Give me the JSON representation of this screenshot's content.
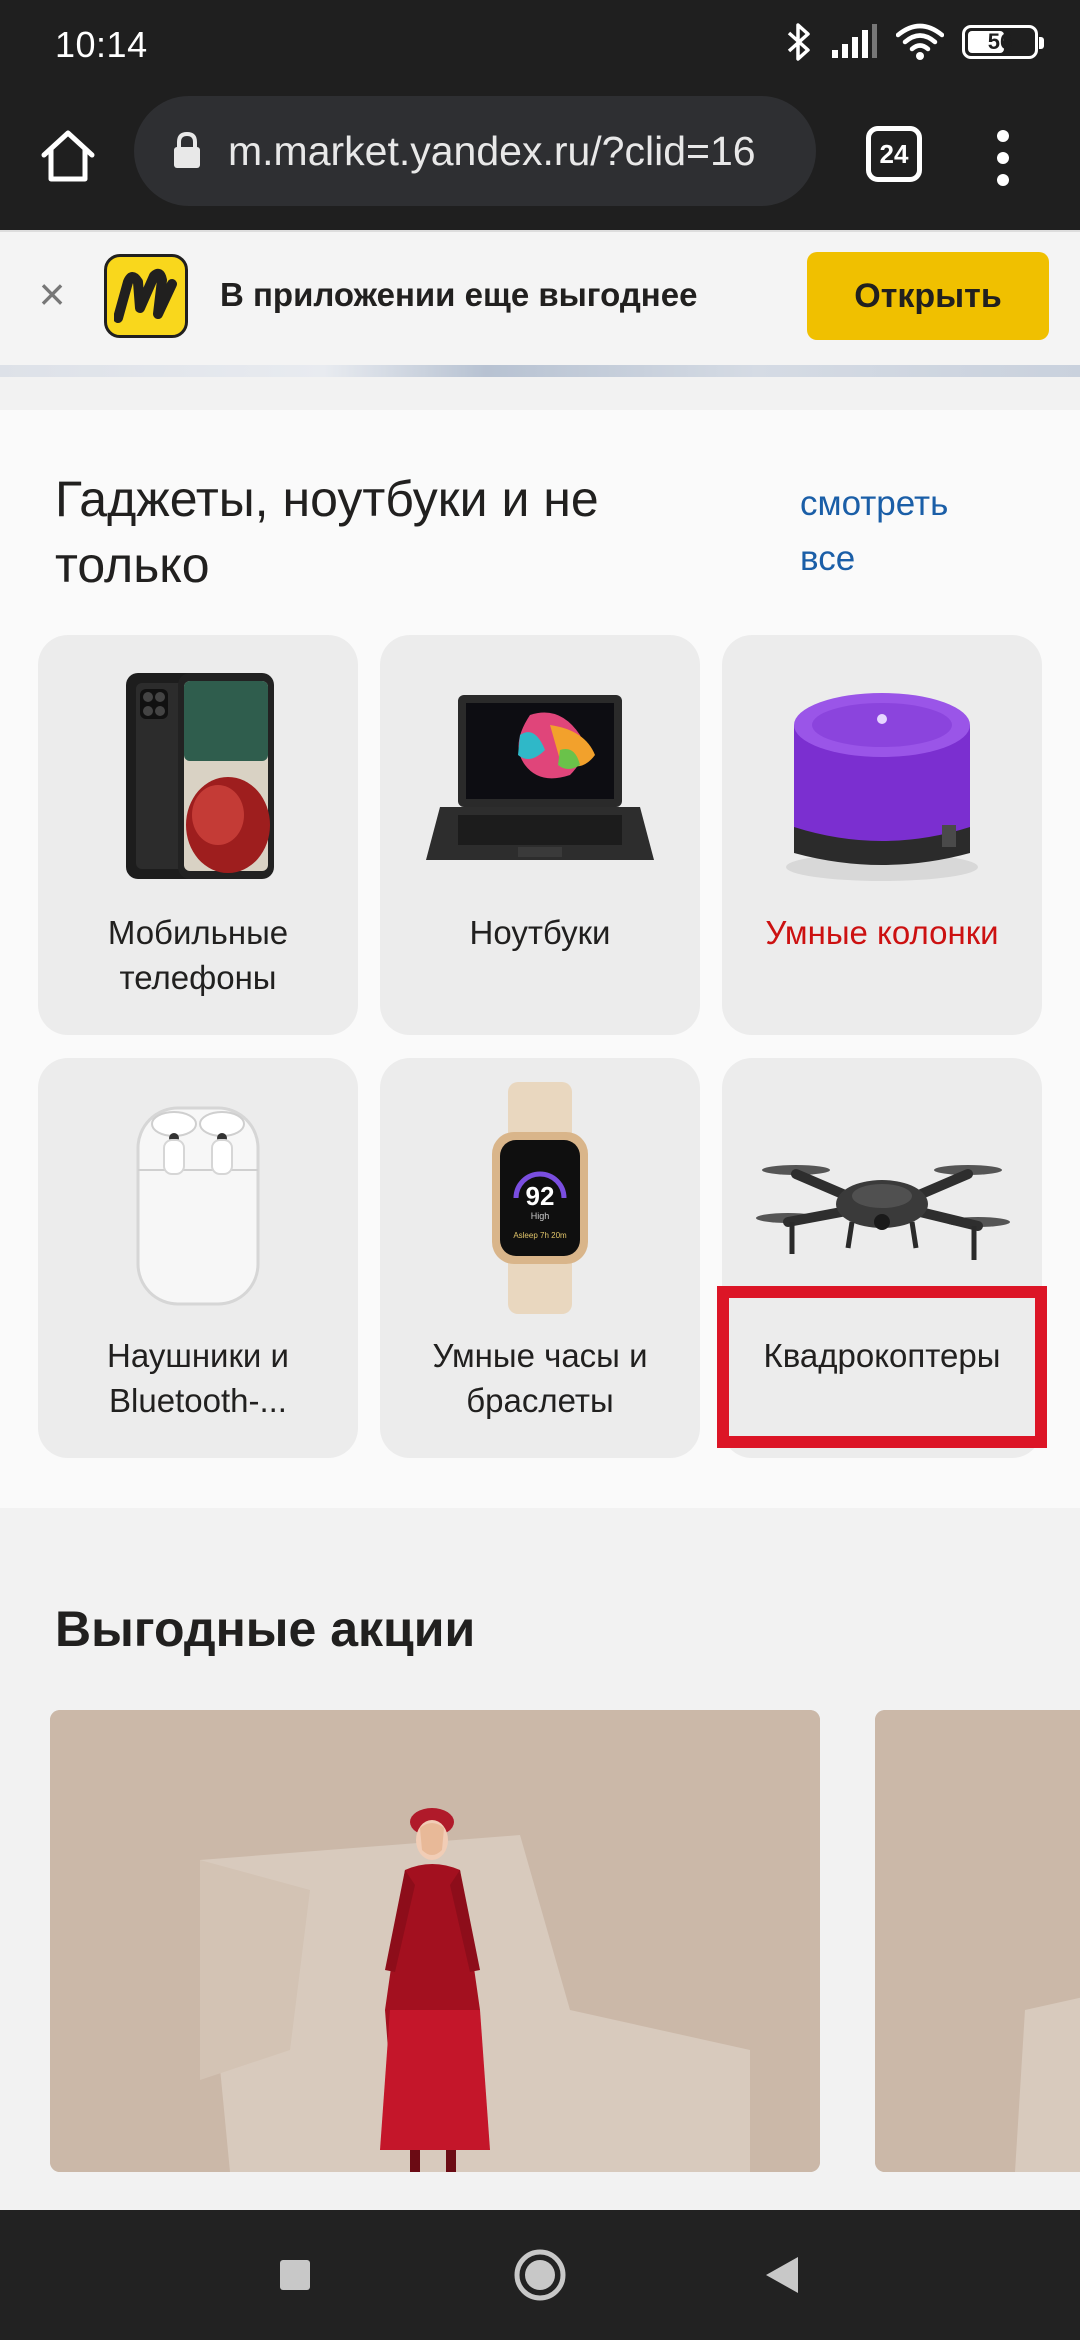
{
  "status_bar": {
    "time": "10:14",
    "battery": "56",
    "battery_level": 0.56
  },
  "browser": {
    "url": "m.market.yandex.ru/?clid=16",
    "tab_count": "24"
  },
  "app_banner": {
    "text": "В приложении еще выгоднее",
    "open_label": "Открыть",
    "logo_letter": "M",
    "logo_color": "#f9d71c",
    "button_color": "#f0c000"
  },
  "gadgets": {
    "title": "Гаджеты, ноутбуки и не только",
    "see_all": "смотреть все",
    "categories": [
      {
        "label": "Мобильные телефоны",
        "icon": "smartphone-icon"
      },
      {
        "label": "Ноутбуки",
        "icon": "laptop-icon"
      },
      {
        "label": "Умные колонки",
        "icon": "smart-speaker-icon",
        "color": "#cc1111"
      },
      {
        "label": "Наушники и Bluetooth-...",
        "icon": "earbuds-case-icon"
      },
      {
        "label": "Умные часы и браслеты",
        "icon": "smartwatch-icon",
        "watch_value": "92",
        "watch_unit": "High",
        "watch_time": "Asleep 7h 20m"
      },
      {
        "label": "Квадрокоптеры",
        "icon": "drone-icon"
      }
    ],
    "highlight_color": "#dc1526"
  },
  "promos": {
    "title": "Выгодные акции"
  },
  "nav": {
    "recents_icon": "square-icon",
    "home_icon": "circle-icon",
    "back_icon": "triangle-back-icon"
  }
}
